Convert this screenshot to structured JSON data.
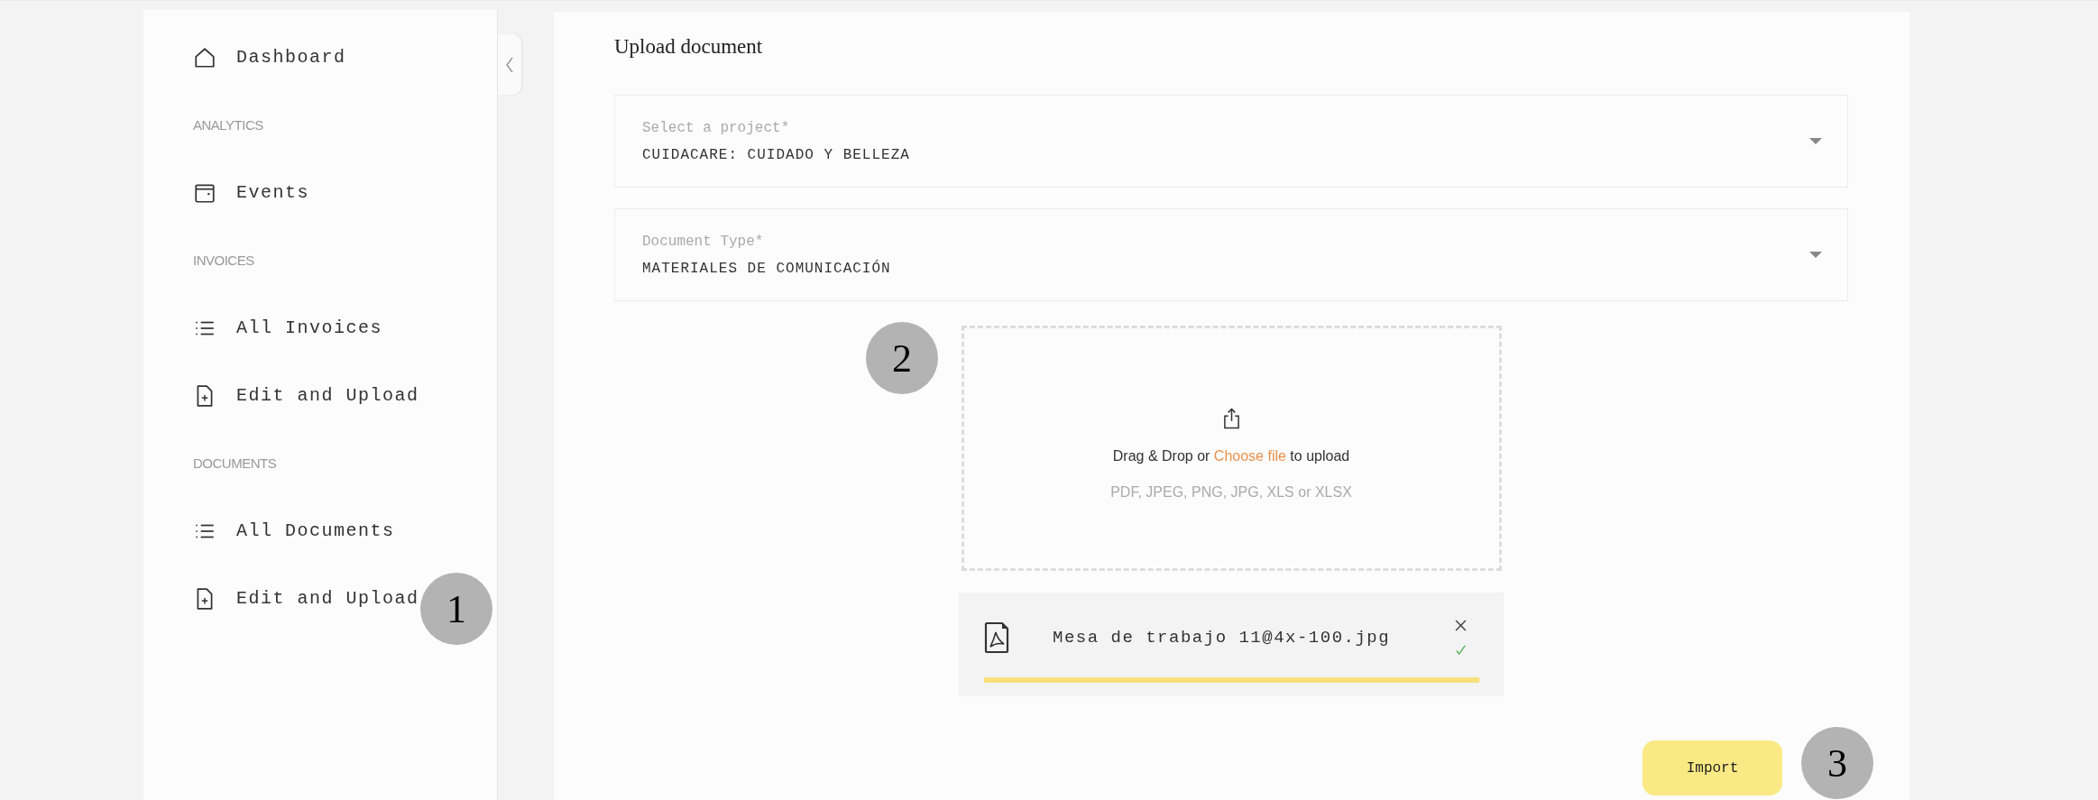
{
  "sidebar": {
    "sections": [
      {
        "items": [
          {
            "label": "Dashboard",
            "kind": "home"
          }
        ]
      },
      {
        "header": "ANALYTICS",
        "items": [
          {
            "label": "Events",
            "kind": "calendar"
          }
        ]
      },
      {
        "header": "INVOICES",
        "items": [
          {
            "label": "All Invoices",
            "kind": "list"
          },
          {
            "label": "Edit and Upload",
            "kind": "file-plus"
          }
        ]
      },
      {
        "header": "DOCUMENTS",
        "items": [
          {
            "label": "All Documents",
            "kind": "list"
          },
          {
            "label": "Edit and Upload",
            "kind": "file-plus"
          }
        ]
      }
    ]
  },
  "page": {
    "title": "Upload document",
    "selects": [
      {
        "label": "Select a project*",
        "value": "CUIDACARE: CUIDADO Y BELLEZA"
      },
      {
        "label": "Document Type*",
        "value": "MATERIALES DE COMUNICACIÓN"
      }
    ],
    "dropzone": {
      "text_before": "Drag & Drop or",
      "link": "Choose file",
      "text_after": "to upload",
      "formats": "PDF, JPEG, PNG, JPG, XLS or XLSX"
    },
    "files": [
      {
        "name": "Mesa de trabajo 11@4x-100.jpg",
        "done": true,
        "level": 1
      }
    ],
    "import_button": "Import"
  },
  "annotations": [
    {
      "label": "1"
    },
    {
      "label": "2"
    },
    {
      "label": "3"
    }
  ]
}
